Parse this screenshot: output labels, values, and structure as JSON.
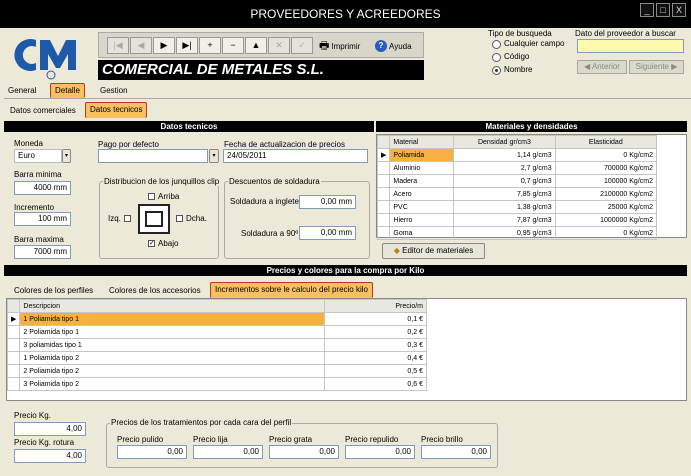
{
  "window": {
    "title": "PROVEEDORES Y ACREEDORES",
    "min": "_",
    "max": "□",
    "close": "X"
  },
  "toolbar": {
    "first": "|◀",
    "prev": "◀",
    "next": "▶",
    "last": "▶|",
    "add": "+",
    "remove": "−",
    "up": "▲",
    "cancel": "✕",
    "ok": "✓",
    "print": "Imprimir",
    "help": "Ayuda"
  },
  "company": "COMERCIAL DE METALES S.L.",
  "search": {
    "type_label": "Tipo de busqueda",
    "options": [
      "Cualquier campo",
      "Código",
      "Nombre"
    ],
    "selected": "Nombre",
    "field_label": "Dato del proveedor a buscar",
    "value": "",
    "prev": "Anterior",
    "next": "Siguiente"
  },
  "tabs": [
    "General",
    "Detalle",
    "Gestion"
  ],
  "subtabs": [
    "Datos comerciales",
    "Datos tecnicos"
  ],
  "tecnicos": {
    "header": "Datos tecnicos",
    "moneda_label": "Moneda",
    "moneda": "Euro",
    "pago_label": "Pago por defecto",
    "pago": "",
    "fecha_label": "Fecha de actualizacion de precios",
    "fecha": "24/05/2011",
    "barra_min_label": "Barra minima",
    "barra_min": "4000 mm",
    "incremento_label": "Incremento",
    "incremento": "100 mm",
    "barra_max_label": "Barra maxima",
    "barra_max": "7000 mm",
    "junquillos_label": "Distribucion de los junquillos clip",
    "arriba": "Arriba",
    "izq": "Izq.",
    "dcha": "Dcha.",
    "abajo": "Abajo",
    "check_mark": "✓",
    "descuentos_label": "Descuentos de soldadura",
    "inglete_label": "Soldadura a inglete",
    "inglete": "0,00 mm",
    "noventa_label": "Soldadura a 90º",
    "noventa": "0,00 mm"
  },
  "materiales": {
    "header": "Materiales y densidades",
    "columns": [
      "Material",
      "Densidad gr/cm3",
      "Elasticidad"
    ],
    "rows": [
      [
        "Poliamida",
        "1,14 g/cm3",
        "0 Kg/cm2"
      ],
      [
        "Aluminio",
        "2,7 g/cm3",
        "700000 Kg/cm2"
      ],
      [
        "Madera",
        "0,7 g/cm3",
        "100000 Kg/cm2"
      ],
      [
        "Acero",
        "7,85 g/cm3",
        "2100000 Kg/cm2"
      ],
      [
        "PVC",
        "1,38 g/cm3",
        "25000 Kg/cm2"
      ],
      [
        "Hierro",
        "7,87 g/cm3",
        "1000000 Kg/cm2"
      ],
      [
        "Goma",
        "0,95 g/cm3",
        "0 Kg/cm2"
      ]
    ],
    "editor": "Editor de materiales"
  },
  "precios": {
    "header": "Precios y colores para la compra por Kilo",
    "tabs": [
      "Colores de los perfiles",
      "Colores de los accesorios",
      "Incrementos sobre le calculo del precio kilo"
    ],
    "columns": [
      "Descripcion",
      "Precio/m"
    ],
    "rows": [
      [
        "1 Poliamida tipo 1",
        "0,1 €"
      ],
      [
        "2 Poliamida tipo 1",
        "0,2 €"
      ],
      [
        "3 poliamidas tipo 1",
        "0,3 €"
      ],
      [
        "1 Poliamida tipo 2",
        "0,4 €"
      ],
      [
        "2 Poliamida tipo 2",
        "0,5 €"
      ],
      [
        "3 Poliamida tipo 2",
        "0,6 €"
      ]
    ],
    "precio_kg_label": "Precio Kg.",
    "precio_kg": "4,00",
    "rotura_label": "Precio Kg. rotura",
    "rotura": "4,00",
    "tratamientos_label": "Precios de los tratamientos por cada cara del perfil",
    "trat": [
      {
        "label": "Precio pulido",
        "value": "0,00"
      },
      {
        "label": "Precio lija",
        "value": "0,00"
      },
      {
        "label": "Precio grata",
        "value": "0,00"
      },
      {
        "label": "Precio repulido",
        "value": "0,00"
      },
      {
        "label": "Precio brillo",
        "value": "0,00"
      }
    ]
  }
}
